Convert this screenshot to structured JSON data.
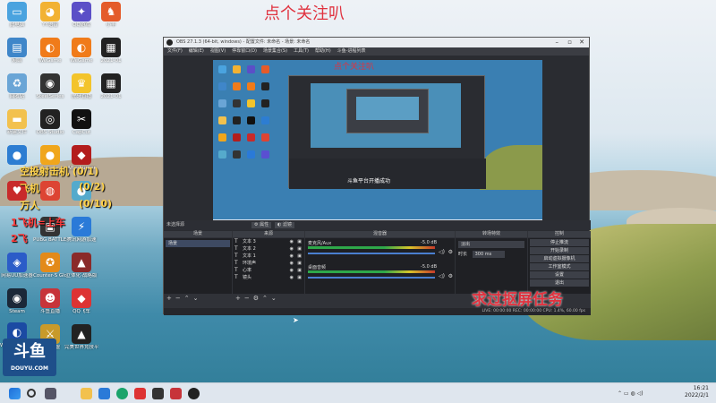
{
  "banner": {
    "top": "点个关注叭",
    "bottom": "求过抠屏任务"
  },
  "desktop": {
    "icons": [
      {
        "label": "此电脑",
        "color": "#4aa3df",
        "glyph": "▭"
      },
      {
        "label": "YY语音",
        "color": "#f2b233",
        "glyph": "◕"
      },
      {
        "label": "QQ游戏",
        "color": "#5b4fc7",
        "glyph": "✦"
      },
      {
        "label": "小羊",
        "color": "#e45b2a",
        "glyph": "♞"
      },
      {
        "label": "网络",
        "color": "#3f86c9",
        "glyph": "▤"
      },
      {
        "label": "WeGame",
        "color": "#f07b1a",
        "glyph": "◐"
      },
      {
        "label": "WeGame",
        "color": "#f07b1a",
        "glyph": "◐"
      },
      {
        "label": "2021-01",
        "color": "#222",
        "glyph": "▦"
      },
      {
        "label": "回收站",
        "color": "#6aa5d6",
        "glyph": "♻"
      },
      {
        "label": "SteelSeries",
        "color": "#333",
        "glyph": "◉"
      },
      {
        "label": "虎牙直播",
        "color": "#f3c42b",
        "glyph": "♛"
      },
      {
        "label": "2021-01",
        "color": "#222",
        "glyph": "▦"
      },
      {
        "label": "新建文件",
        "color": "#f2c14e",
        "glyph": "▬"
      },
      {
        "label": "OBS Studio",
        "color": "#222",
        "glyph": "◎"
      },
      {
        "label": "CapCut",
        "color": "#111",
        "glyph": "✂"
      },
      {
        "label": "",
        "color": "#2d7dd2",
        "glyph": "●"
      },
      {
        "label": "",
        "color": "#f0a61c",
        "glyph": "●"
      },
      {
        "label": "Afterburner",
        "color": "#b31d1d",
        "glyph": "◆"
      },
      {
        "label": "",
        "color": "#c82a2a",
        "glyph": "♥"
      },
      {
        "label": "",
        "color": "#d43",
        "glyph": "◍"
      },
      {
        "label": "",
        "color": "#5ac",
        "glyph": "●"
      },
      {
        "label": "PUBG BATTLEGR",
        "color": "#333",
        "glyph": "▣"
      },
      {
        "label": "腾讯网游加速",
        "color": "#2a7ad8",
        "glyph": "⚡"
      },
      {
        "label": "",
        "color": "#5a4fd1",
        "glyph": "◎"
      },
      {
        "label": "网易UU加速器",
        "color": "#2b5cc8",
        "glyph": "◈"
      },
      {
        "label": "Counter-S Global Off",
        "color": "#e38a1a",
        "glyph": "✪"
      },
      {
        "label": "立体化·战略版",
        "color": "#8a2a2a",
        "glyph": "▲"
      },
      {
        "label": "Steam",
        "color": "#1b2838",
        "glyph": "◉"
      },
      {
        "label": "斗鱼直播",
        "color": "#c7343a",
        "glyph": "☻"
      },
      {
        "label": "QQ飞车",
        "color": "#d33",
        "glyph": "◆"
      },
      {
        "label": "Wallpaper Engine",
        "color": "#1b4aa3",
        "glyph": "◐"
      },
      {
        "label": "英雄联盟",
        "color": "#c89a2a",
        "glyph": "⚔"
      },
      {
        "label": "完美世界竞技平台",
        "color": "#222",
        "glyph": "▲"
      }
    ],
    "overlay": {
      "line1": "空投射击机 (0/1)",
      "line2": "飞机",
      "line2b": "(0/2)",
      "line3": "万人",
      "line3b": "(0/10)",
      "line4": "1飞机=上车",
      "line5": "2飞"
    },
    "douyu": {
      "mark": "斗鱼",
      "text": "DOUYU.COM"
    }
  },
  "obs": {
    "title": "OBS 27.1.3 (64-bit, windows) - 配置文件: 未命名 - 场景: 未命名",
    "menu": [
      "文件(F)",
      "编辑(E)",
      "视图(V)",
      "停靠窗口(D)",
      "场景集合(S)",
      "工具(T)",
      "帮助(H)",
      "斗鱼-进程列表"
    ],
    "preview_banner": "点个关注叭",
    "preview_note": "斗鱼平台开播成功",
    "scene_header": "场景",
    "sources_header": "来源",
    "mixer_header": "混音器",
    "transition_header": "转场特效",
    "controls_header": "控制",
    "tabs": {
      "scene_tab": "未选择源",
      "props": "属性",
      "filters": "滤镜"
    },
    "scenes": [
      "场景"
    ],
    "sources": [
      "文本 3",
      "文本 2",
      "文本 1",
      "环境声",
      "心率",
      "镜头"
    ],
    "mixer": [
      {
        "name": "麦克风/Aux",
        "db": "-5.0 dB"
      },
      {
        "name": "桌面音频",
        "db": "-5.0 dB"
      }
    ],
    "transition": {
      "type": "淡出",
      "duration_label": "时长",
      "duration": "300 ms"
    },
    "controls": [
      "停止推流",
      "开始录制",
      "启动虚拟摄像机",
      "工作室模式",
      "设置",
      "退出"
    ],
    "status": "LIVE: 00:00:00   REC: 00:00:00   CPU: 1.4%, 60.00 fps"
  },
  "taskbar": {
    "time": "16:21",
    "date": "2022/2/1"
  }
}
